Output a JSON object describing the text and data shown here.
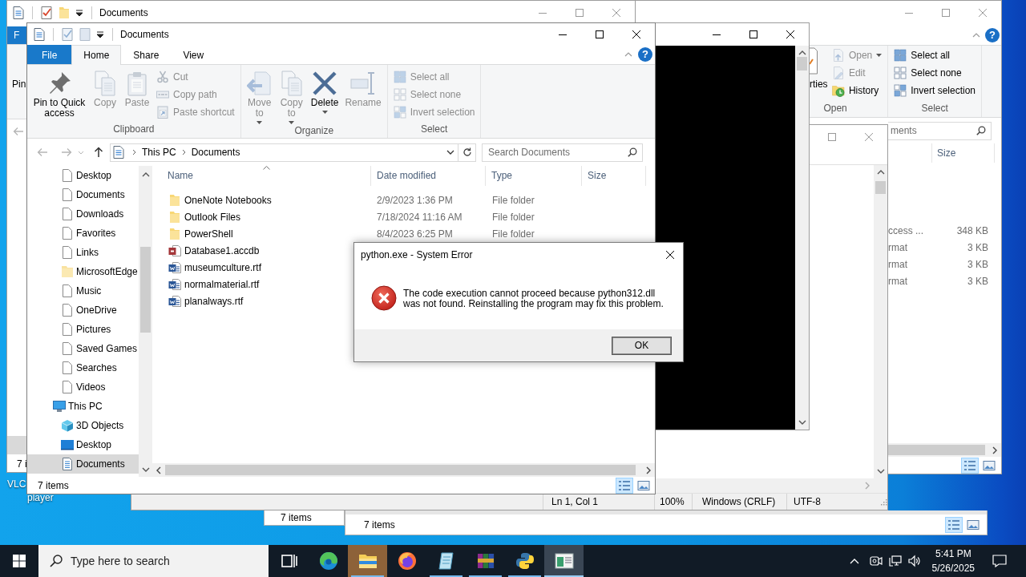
{
  "desktop_icon": {
    "label_lines": [
      "VLC",
      "player"
    ]
  },
  "back_explorer": {
    "title": "Documents",
    "file_tab": "F",
    "ribbon_button_label": "Pin",
    "status": "7 i"
  },
  "right_explorer": {
    "help_label": "?",
    "ribbon_groups": [
      {
        "label": "Open",
        "buttons": [
          {
            "label": "rties",
            "kind": "large",
            "disabled": false,
            "dropdown": false
          },
          {
            "label": "Open",
            "kind": "small",
            "disabled": true,
            "dropdown": true
          },
          {
            "label": "Edit",
            "kind": "small",
            "disabled": true,
            "dropdown": false
          },
          {
            "label": "History",
            "kind": "small",
            "disabled": false,
            "dropdown": false
          }
        ]
      },
      {
        "label": "Select",
        "buttons": [
          {
            "label": "Select all",
            "kind": "small",
            "disabled": false,
            "dropdown": false
          },
          {
            "label": "Select none",
            "kind": "small",
            "disabled": false,
            "dropdown": false
          },
          {
            "label": "Invert selection",
            "kind": "small",
            "disabled": false,
            "dropdown": false
          }
        ]
      }
    ],
    "search_placeholder": "ments",
    "columns": [
      {
        "label": "Size"
      }
    ],
    "rows": [
      {
        "column_1": "ccess ...",
        "size": "348 KB"
      },
      {
        "column_1": "rmat",
        "size": "3 KB"
      },
      {
        "column_1": "rmat",
        "size": "3 KB"
      },
      {
        "column_1": "rmat",
        "size": "3 KB"
      }
    ],
    "view_buttons": [
      {
        "kind": "details",
        "selected": true
      },
      {
        "kind": "thumbnails",
        "selected": false
      }
    ]
  },
  "notepad": {
    "status_fields": [
      "Ln 1, Col 1",
      "100%",
      "Windows (CRLF)",
      "UTF-8"
    ]
  },
  "bottom_explorer_left": {
    "status": "7 items"
  },
  "bottom_explorer_right": {
    "status": "7 items",
    "view_buttons": [
      {
        "kind": "details",
        "selected": true
      },
      {
        "kind": "thumbnails",
        "selected": false
      }
    ]
  },
  "front_explorer": {
    "title": "Documents",
    "tabs": [
      {
        "label": "File",
        "kind": "file",
        "selected": false
      },
      {
        "label": "Home",
        "kind": "tab",
        "selected": true
      },
      {
        "label": "Share",
        "kind": "tab",
        "selected": false
      },
      {
        "label": "View",
        "kind": "tab",
        "selected": false
      }
    ],
    "help_label": "?",
    "ribbon_groups": [
      {
        "label": "Clipboard",
        "buttons": [
          {
            "label": "Pin to Quick access",
            "kind": "large",
            "disabled": false,
            "dropdown": false
          },
          {
            "label": "Copy",
            "kind": "large",
            "disabled": true,
            "dropdown": false
          },
          {
            "label": "Paste",
            "kind": "large",
            "disabled": true,
            "dropdown": false
          },
          {
            "label": "Cut",
            "kind": "small",
            "disabled": true,
            "dropdown": false
          },
          {
            "label": "Copy path",
            "kind": "small",
            "disabled": true,
            "dropdown": false
          },
          {
            "label": "Paste shortcut",
            "kind": "small",
            "disabled": true,
            "dropdown": false
          }
        ]
      },
      {
        "label": "Organize",
        "buttons": [
          {
            "label": "Move to",
            "kind": "large",
            "disabled": true,
            "dropdown": true
          },
          {
            "label": "Copy to",
            "kind": "large",
            "disabled": true,
            "dropdown": true
          },
          {
            "label": "Delete",
            "kind": "large",
            "disabled": false,
            "dropdown": true
          },
          {
            "label": "Rename",
            "kind": "large",
            "disabled": true,
            "dropdown": false
          }
        ]
      },
      {
        "label": "Select",
        "buttons": [
          {
            "label": "Select all",
            "kind": "small",
            "disabled": true,
            "dropdown": false
          },
          {
            "label": "Select none",
            "kind": "small",
            "disabled": true,
            "dropdown": false
          },
          {
            "label": "Invert selection",
            "kind": "small",
            "disabled": true,
            "dropdown": false
          }
        ]
      }
    ],
    "breadcrumbs": [
      "This PC",
      "Documents"
    ],
    "search_placeholder": "Search Documents",
    "navigation_pane": {
      "items": [
        {
          "children": [
            {
              "label": "Desktop",
              "kind": "item",
              "selected": false
            },
            {
              "label": "Documents",
              "kind": "item",
              "selected": false
            },
            {
              "label": "Downloads",
              "kind": "item",
              "selected": false
            },
            {
              "label": "Favorites",
              "kind": "item",
              "selected": false
            },
            {
              "label": "Links",
              "kind": "item",
              "selected": false
            },
            {
              "label": "MicrosoftEdge",
              "kind": "folder",
              "selected": false
            },
            {
              "label": "Music",
              "kind": "item",
              "selected": false
            },
            {
              "label": "OneDrive",
              "kind": "item",
              "selected": false
            },
            {
              "label": "Pictures",
              "kind": "item",
              "selected": false
            },
            {
              "label": "Saved Games",
              "kind": "item",
              "selected": false
            },
            {
              "label": "Searches",
              "kind": "item",
              "selected": false
            },
            {
              "label": "Videos",
              "kind": "item",
              "selected": false
            }
          ]
        },
        {
          "label": "This PC",
          "kind": "computer",
          "selected": false,
          "children": [
            {
              "label": "3D Objects",
              "kind": "objects3d",
              "selected": false
            },
            {
              "label": "Desktop",
              "kind": "desktop",
              "selected": false
            },
            {
              "label": "Documents",
              "kind": "documents",
              "selected": true
            }
          ]
        }
      ]
    },
    "columns": [
      {
        "label": "Name",
        "sorted": true
      },
      {
        "label": "Date modified",
        "sorted": false
      },
      {
        "label": "Type",
        "sorted": false
      },
      {
        "label": "Size",
        "sorted": false
      }
    ],
    "rows": [
      {
        "name": "OneNote Notebooks",
        "kind": "folder",
        "date_modified": "2/9/2023 1:36 PM",
        "type": "File folder",
        "selected": false
      },
      {
        "name": "Outlook Files",
        "kind": "folder",
        "date_modified": "7/18/2024 11:16 AM",
        "type": "File folder",
        "selected": false
      },
      {
        "name": "PowerShell",
        "kind": "folder",
        "date_modified": "8/4/2023 6:25 PM",
        "type": "File folder",
        "selected": false
      },
      {
        "name": "Database1.accdb",
        "kind": "database",
        "selected": false
      },
      {
        "name": "museumculture.rtf",
        "kind": "document",
        "selected": false
      },
      {
        "name": "normalmaterial.rtf",
        "kind": "document",
        "selected": false
      },
      {
        "name": "planalways.rtf",
        "kind": "document",
        "selected": false
      }
    ],
    "status": "7 items",
    "view_buttons": [
      {
        "kind": "details",
        "selected": true
      },
      {
        "kind": "thumbnails",
        "selected": false
      }
    ]
  },
  "error_dialog": {
    "title": "python.exe - System Error",
    "kind": "error",
    "message": "The code execution cannot proceed because python312.dll was not found. Reinstalling the program may fix this problem.",
    "buttons": [
      {
        "label": "OK",
        "default": true
      }
    ]
  },
  "taskbar": {
    "search_placeholder": "Type here to search",
    "apps": [
      {
        "kind": "taskview",
        "running": false,
        "selected": false,
        "flashing": false
      },
      {
        "kind": "edge",
        "running": false,
        "selected": false,
        "flashing": false
      },
      {
        "kind": "explorer",
        "running": true,
        "selected": false,
        "flashing": true
      },
      {
        "kind": "firefox",
        "running": false,
        "selected": false,
        "flashing": false
      },
      {
        "kind": "notepad",
        "running": true,
        "selected": false,
        "flashing": false
      },
      {
        "kind": "archive",
        "running": true,
        "selected": false,
        "flashing": false
      },
      {
        "kind": "python",
        "running": true,
        "selected": false,
        "flashing": false
      },
      {
        "kind": "window",
        "running": true,
        "selected": true,
        "flashing": false
      }
    ],
    "clock": {
      "time": "5:41 PM",
      "date": "5/26/2025"
    }
  }
}
